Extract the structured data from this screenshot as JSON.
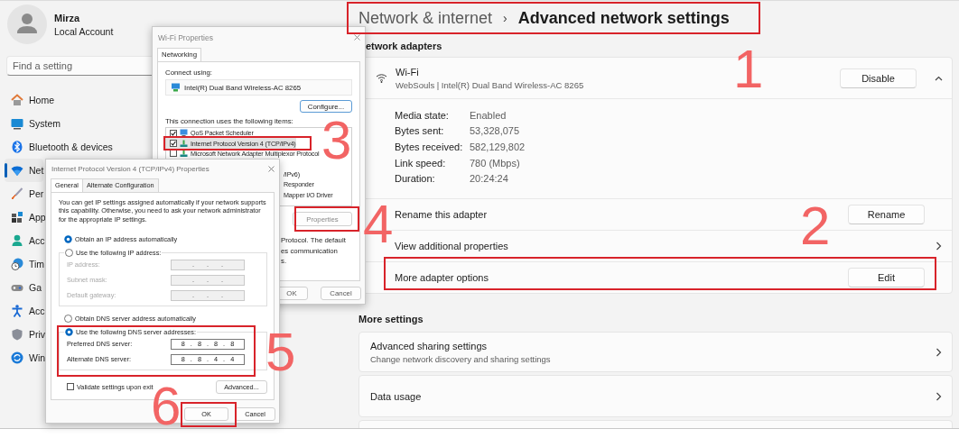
{
  "profile": {
    "name": "Mirza",
    "account": "Local Account"
  },
  "search": {
    "placeholder": "Find a setting"
  },
  "nav": [
    {
      "label": "Home",
      "selected": false
    },
    {
      "label": "System",
      "selected": false
    },
    {
      "label": "Bluetooth & devices",
      "selected": false
    },
    {
      "label": "Net",
      "selected": true
    },
    {
      "label": "Per",
      "selected": false
    },
    {
      "label": "App",
      "selected": false
    },
    {
      "label": "Acc",
      "selected": false
    },
    {
      "label": "Tim",
      "selected": false
    },
    {
      "label": "Ga",
      "selected": false
    },
    {
      "label": "Acc",
      "selected": false
    },
    {
      "label": "Priv",
      "selected": false
    },
    {
      "label": "Win",
      "selected": false
    }
  ],
  "breadcrumb": {
    "parent": "Network & internet",
    "separator": "›",
    "current": "Advanced network settings"
  },
  "network_adapters": {
    "heading": "etwork adapters",
    "adapter": {
      "name": "Wi-Fi",
      "description": "WebSouls | Intel(R) Dual Band Wireless-AC 8265",
      "button": "Disable",
      "expanded": true,
      "details": [
        {
          "label": "Media state:",
          "value": "Enabled"
        },
        {
          "label": "Bytes sent:",
          "value": "53,328,075"
        },
        {
          "label": "Bytes received:",
          "value": "582,129,802"
        },
        {
          "label": "Link speed:",
          "value": "780 (Mbps)"
        },
        {
          "label": "Duration:",
          "value": "20:24:24"
        }
      ],
      "actions": [
        {
          "label": "Rename this adapter",
          "kind": "button",
          "button": "Rename"
        },
        {
          "label": "View additional properties",
          "kind": "link"
        },
        {
          "label": "More adapter options",
          "kind": "button",
          "button": "Edit"
        }
      ]
    }
  },
  "more_settings": {
    "heading": "More settings",
    "items": [
      {
        "title": "Advanced sharing settings",
        "subtitle": "Change network discovery and sharing settings"
      },
      {
        "title": "Data usage"
      }
    ]
  },
  "wifi_dialog": {
    "title": "Wi-Fi Properties",
    "tabs": [
      {
        "label": "Networking",
        "selected": true
      }
    ],
    "connect_label": "Connect using:",
    "adapter": "Intel(R) Dual Band Wireless-AC 8265",
    "configure_button": "Configure...",
    "items_label": "This connection uses the following items:",
    "items": [
      {
        "kind": "item",
        "label": "QoS Packet Scheduler",
        "checked": true,
        "selected": false
      },
      {
        "kind": "item",
        "label": "Internet Protocol Version 4 (TCP/IPv4)",
        "checked": true,
        "selected": true
      },
      {
        "kind": "item",
        "label": "Microsoft Network Adapter Multiplexor Protocol",
        "checked": false,
        "selected": false
      },
      {
        "kind": "fragment",
        "label": "/IPv6)",
        "selected": false
      },
      {
        "kind": "fragment",
        "label": "Responder",
        "selected": false
      },
      {
        "kind": "fragment",
        "label": "Mapper I/O Driver",
        "selected": false
      }
    ],
    "properties_button": "Properties",
    "description": [
      "Protocol. The default",
      "es communication",
      "s."
    ],
    "ok_button": "OK",
    "cancel_button": "Cancel"
  },
  "tcp_dialog": {
    "title": "Internet Protocol Version 4 (TCP/IPv4) Properties",
    "tabs": [
      {
        "label": "General",
        "selected": true
      },
      {
        "label": "Alternate Configuration",
        "selected": false
      }
    ],
    "description": "You can get IP settings assigned automatically if your network supports this capability. Otherwise, you need to ask your network administrator for the appropriate IP settings.",
    "ip_mode": [
      {
        "label": "Obtain an IP address automatically",
        "selected": true
      },
      {
        "label": "Use the following IP address:",
        "selected": false
      }
    ],
    "ip_fields": [
      {
        "label": "IP address:",
        "value": ". . .",
        "disabled": true
      },
      {
        "label": "Subnet mask:",
        "value": ". . .",
        "disabled": true
      },
      {
        "label": "Default gateway:",
        "value": ". . .",
        "disabled": true
      }
    ],
    "dns_mode": [
      {
        "label": "Obtain DNS server address automatically",
        "selected": false
      },
      {
        "label": "Use the following DNS server addresses:",
        "selected": true
      }
    ],
    "dns_fields": [
      {
        "label": "Preferred DNS server:",
        "value": "8 . 8 . 8 . 8",
        "disabled": false
      },
      {
        "label": "Alternate DNS server:",
        "value": "8 . 8 . 4 . 4",
        "disabled": false
      }
    ],
    "validate": {
      "label": "Validate settings upon exit",
      "checked": false
    },
    "advanced_button": "Advanced...",
    "ok_button": "OK",
    "cancel_button": "Cancel"
  },
  "annotations": [
    {
      "label": "1"
    },
    {
      "label": "2"
    },
    {
      "label": "3"
    },
    {
      "label": "4"
    },
    {
      "label": "5"
    },
    {
      "label": "6"
    }
  ]
}
